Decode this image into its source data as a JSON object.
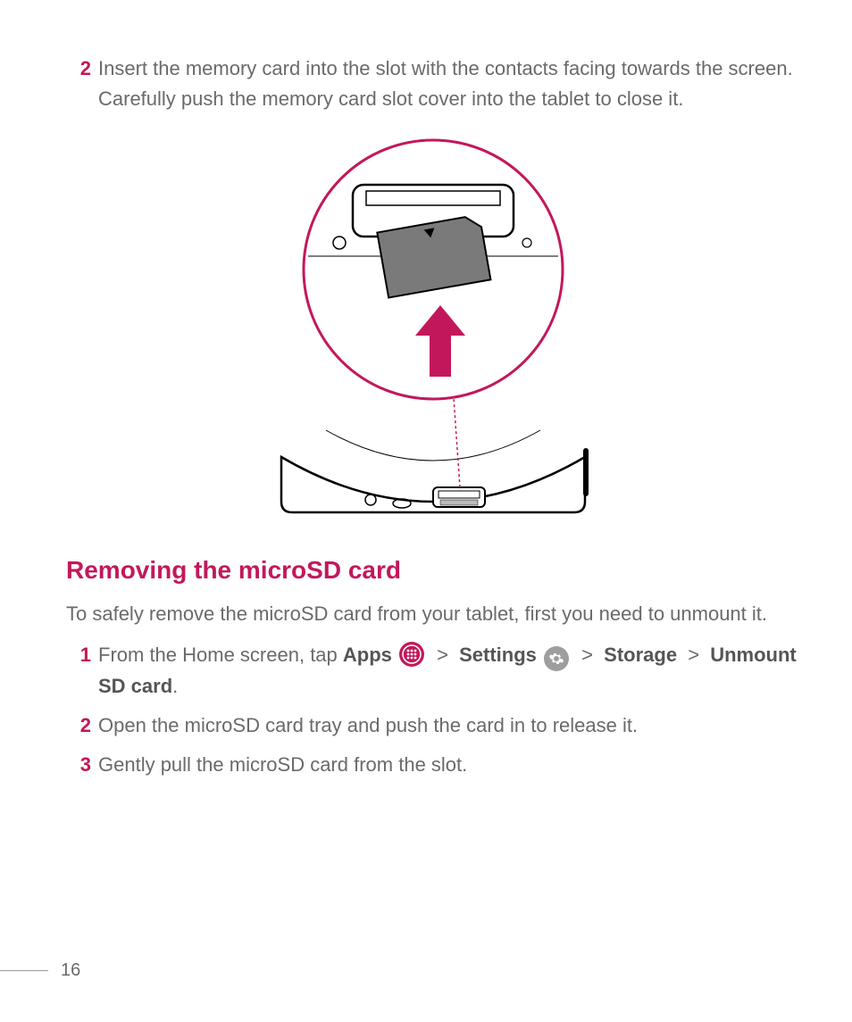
{
  "steps_top": [
    {
      "num": "2",
      "text": "Insert the memory card into the slot with the contacts facing towards the screen. Carefully push the memory card slot cover into the tablet to close it."
    }
  ],
  "heading": "Removing the microSD card",
  "intro": "To safely remove the microSD card from your tablet, first you need to unmount it.",
  "step1": {
    "num": "1",
    "prefix": "From the Home screen, tap ",
    "apps": "Apps",
    "settings": "Settings",
    "storage": "Storage",
    "unmount": "Unmount SD card",
    "gt": ">",
    "period": "."
  },
  "steps_bottom": [
    {
      "num": "2",
      "text": "Open the microSD card tray and push the card in to release it."
    },
    {
      "num": "3",
      "text": "Gently pull the microSD card from the slot."
    }
  ],
  "page_number": "16"
}
